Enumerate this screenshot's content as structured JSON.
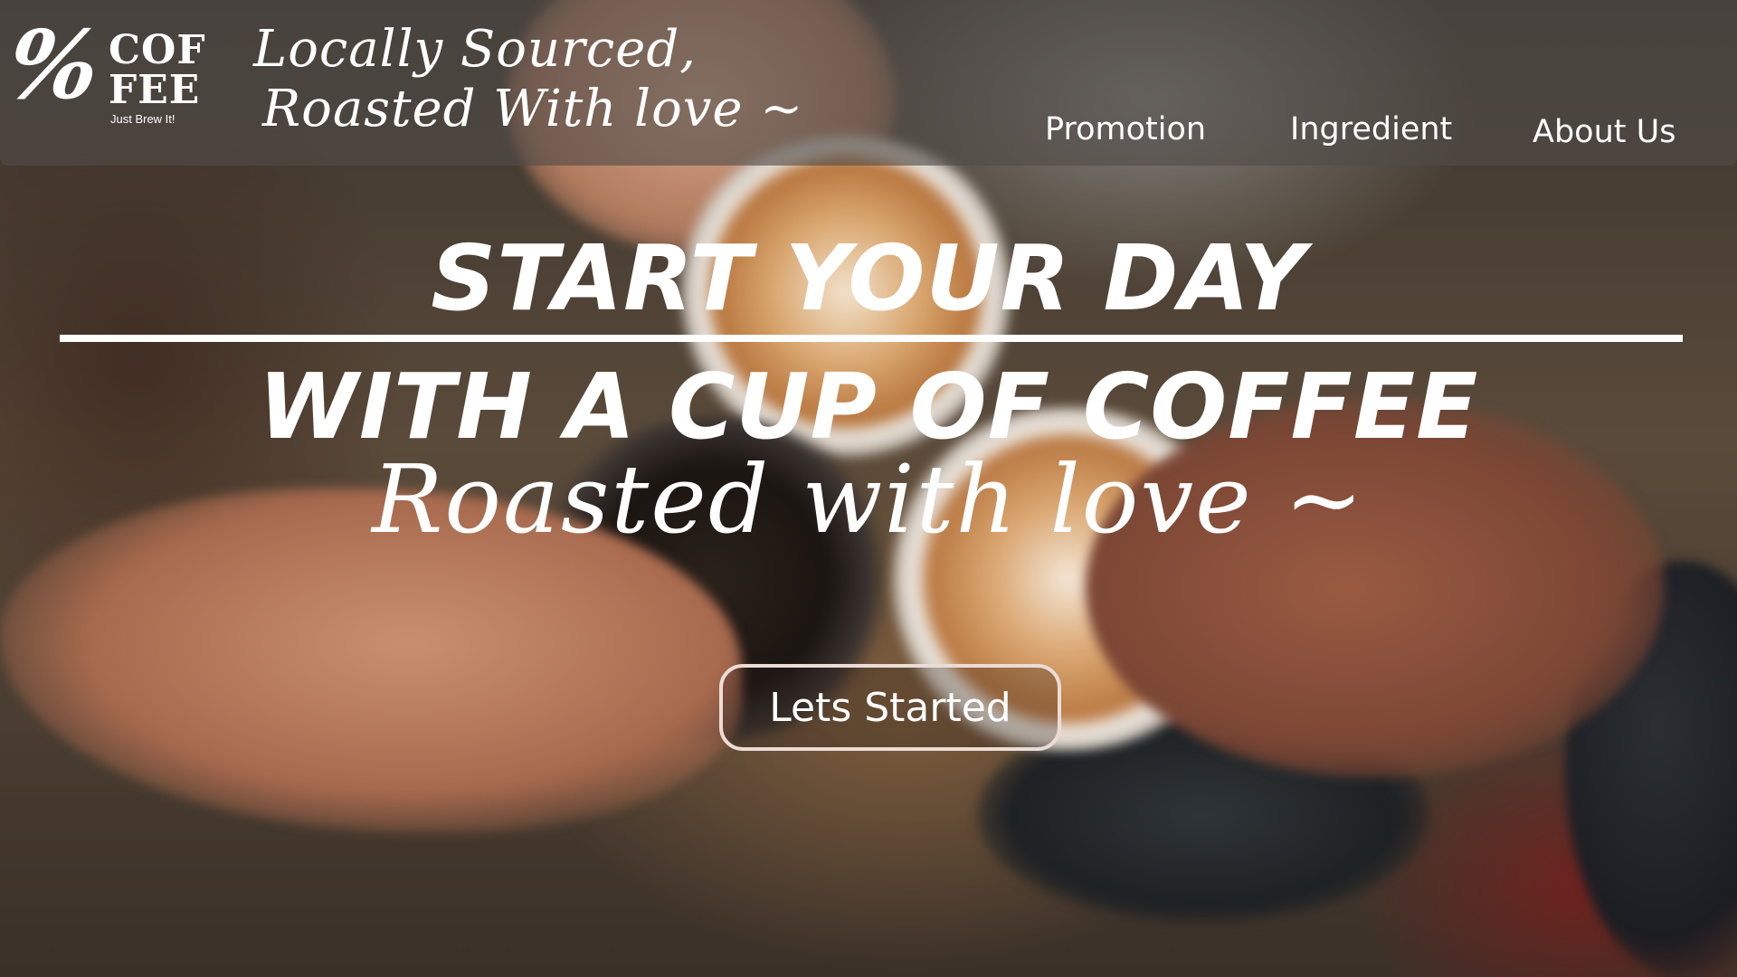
{
  "header": {
    "logo": {
      "symbol": "%",
      "word_top": "COF",
      "word_bottom": "FEE",
      "tagline": "Just Brew It!"
    },
    "tagline": {
      "line1": "Locally Sourced,",
      "line2": "Roasted With love ~"
    },
    "nav": [
      {
        "label": "Promotion"
      },
      {
        "label": "Ingredient"
      },
      {
        "label": "About Us"
      }
    ]
  },
  "hero": {
    "line1": "START YOUR DAY",
    "line2": "WITH A CUP OF COFFEE",
    "script": "Roasted with love ~",
    "cta_label": "Lets Started"
  },
  "background": {
    "description_icon": "coffee-cups-photo-background"
  }
}
